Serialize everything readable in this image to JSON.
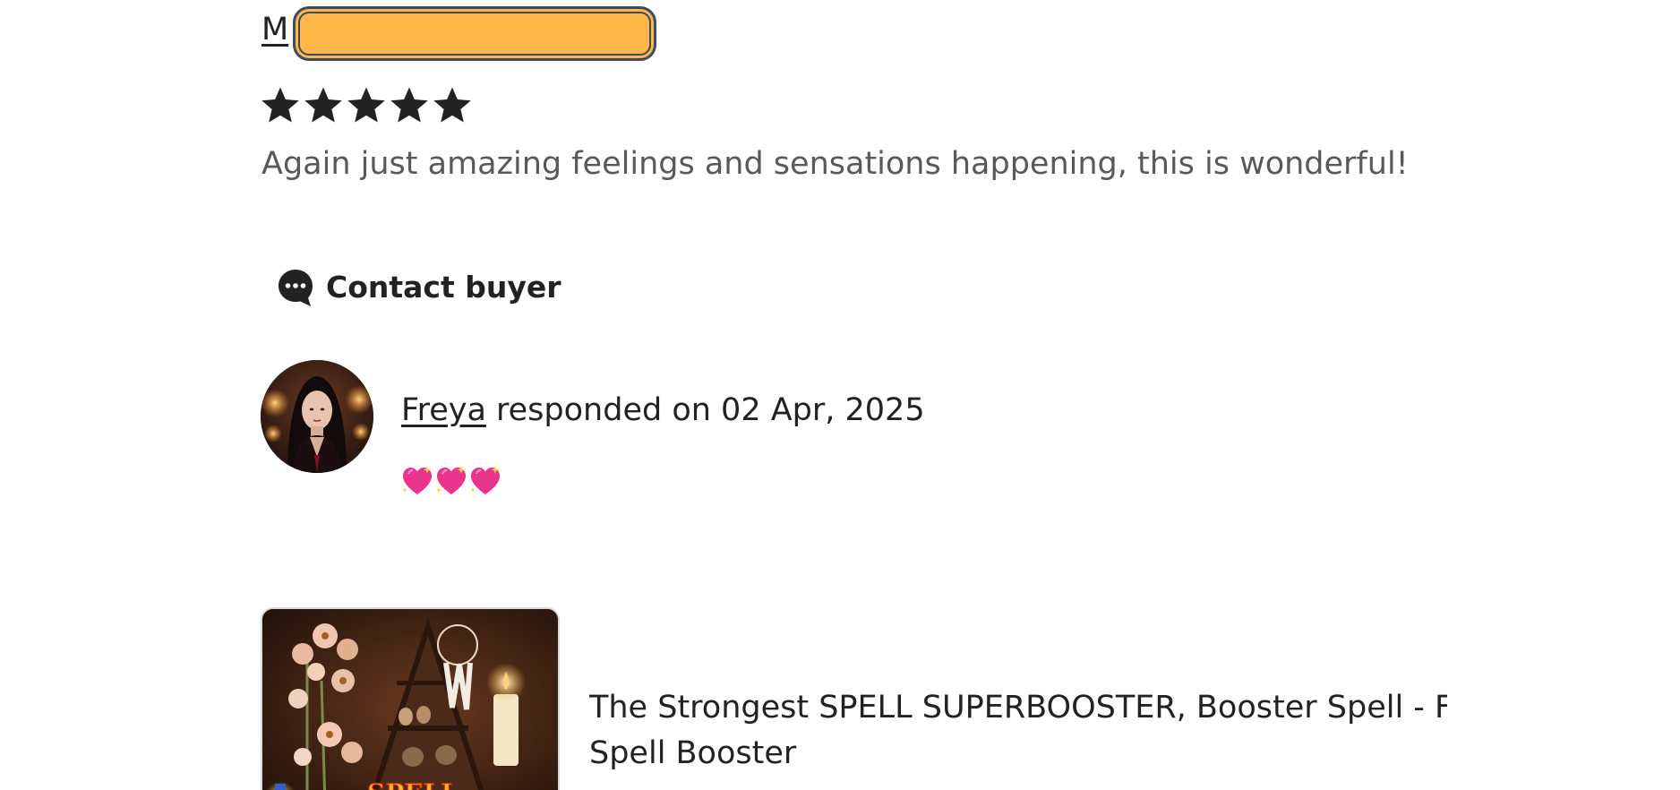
{
  "review": {
    "reviewer_initial": "M",
    "rating": 5,
    "rating_max": 5,
    "text": "Again just amazing feelings and sensations happening, this is wonderful!"
  },
  "contact": {
    "label": "Contact buyer",
    "icon": "chat-bubble-icon"
  },
  "response": {
    "seller_name": "Freya",
    "text": " responded on 02 Apr, 2025",
    "emoji": "💖💖💖"
  },
  "product": {
    "title": "The Strongest SPELL SUPERBOOSTER, Booster Spell - F Spell Booster",
    "thumbnail_text": "SPELL"
  },
  "colors": {
    "redaction_fill": "#ffb74a",
    "redaction_border": "#3c4a63",
    "text_primary": "#222222",
    "text_secondary": "#595959"
  }
}
